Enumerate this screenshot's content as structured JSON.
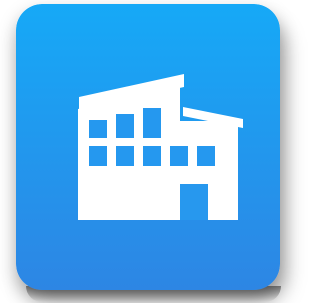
{
  "app_icon": {
    "icon_name": "building-icon",
    "colors": {
      "tile_top": "#1aa5f5",
      "tile_bottom": "#2a88e6",
      "glyph": "#ffffff",
      "window": "#2596ef"
    }
  }
}
